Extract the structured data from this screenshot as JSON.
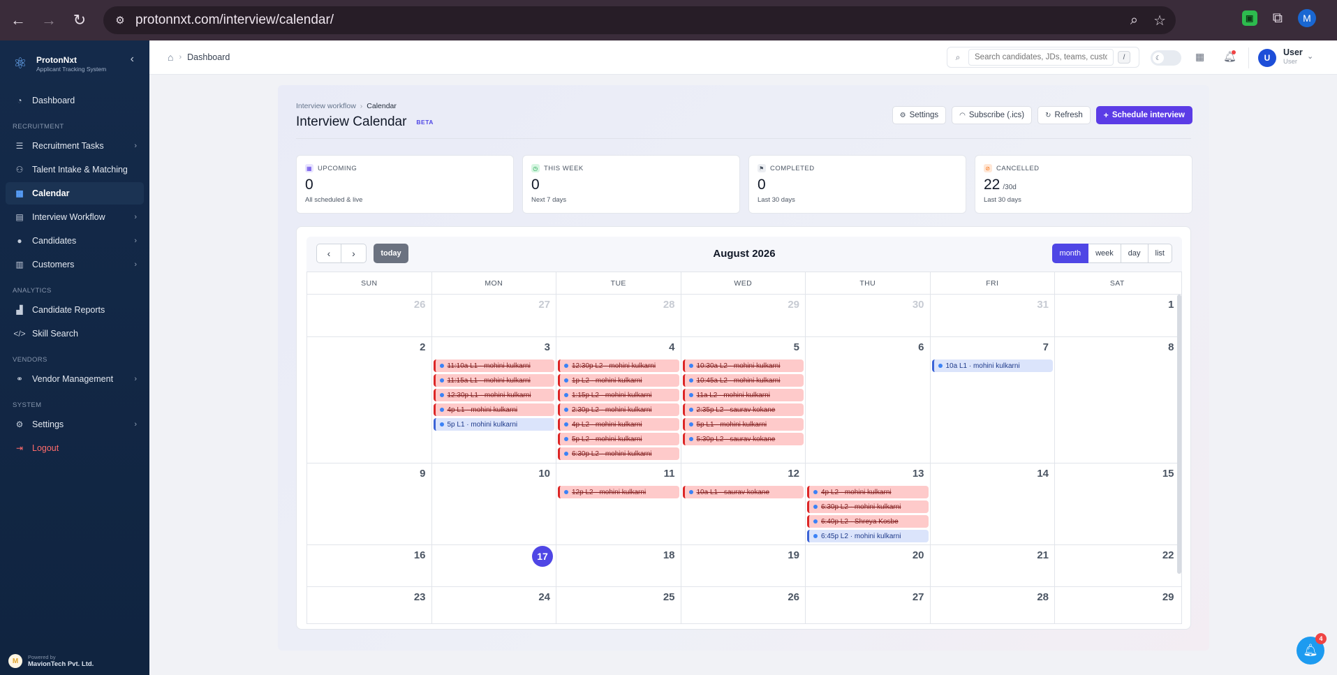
{
  "browser": {
    "url": "protonnxt.com/interview/calendar/",
    "profile_initial": "M"
  },
  "brand": {
    "name": "ProtonNxt",
    "tagline": "Applicant Tracking System"
  },
  "sidebar": {
    "dashboard": "Dashboard",
    "section_recruitment": "RECRUITMENT",
    "recruitment_tasks": "Recruitment Tasks",
    "talent_intake": "Talent Intake & Matching",
    "calendar": "Calendar",
    "interview_workflow": "Interview Workflow",
    "candidates": "Candidates",
    "customers": "Customers",
    "section_analytics": "ANALYTICS",
    "candidate_reports": "Candidate Reports",
    "skill_search": "Skill Search",
    "section_vendors": "VENDORS",
    "vendor_management": "Vendor Management",
    "section_system": "SYSTEM",
    "settings": "Settings",
    "logout": "Logout",
    "powered_by": "Powered by",
    "powered_company": "MavionTech Pvt. Ltd."
  },
  "header": {
    "breadcrumb": "Dashboard",
    "search_placeholder": "Search candidates, JDs, teams, customers",
    "search_kbd": "/",
    "user_initial": "U",
    "user_name": "User",
    "user_role": "User"
  },
  "page": {
    "crumb_parent": "Interview workflow",
    "crumb_current": "Calendar",
    "title": "Interview Calendar",
    "badge": "BETA",
    "btn_settings": "Settings",
    "btn_subscribe": "Subscribe (.ics)",
    "btn_refresh": "Refresh",
    "btn_schedule": "Schedule interview"
  },
  "stats": {
    "upcoming": {
      "label": "UPCOMING",
      "value": "0",
      "sub": "All scheduled & live"
    },
    "this_week": {
      "label": "THIS WEEK",
      "value": "0",
      "sub": "Next 7 days"
    },
    "completed": {
      "label": "COMPLETED",
      "value": "0",
      "sub": "Last 30 days"
    },
    "cancelled": {
      "label": "CANCELLED",
      "value": "22",
      "suffix": "/30d",
      "sub": "Last 30 days"
    }
  },
  "calendar": {
    "title": "August 2026",
    "today_label": "today",
    "views": [
      "month",
      "week",
      "day",
      "list"
    ],
    "active_view": "month",
    "weekdays": [
      "SUN",
      "MON",
      "TUE",
      "WED",
      "THU",
      "FRI",
      "SAT"
    ],
    "today_day": 17,
    "weeks": [
      [
        {
          "d": "26",
          "other": true,
          "events": []
        },
        {
          "d": "27",
          "other": true,
          "events": []
        },
        {
          "d": "28",
          "other": true,
          "events": []
        },
        {
          "d": "29",
          "other": true,
          "events": []
        },
        {
          "d": "30",
          "other": true,
          "events": []
        },
        {
          "d": "31",
          "other": true,
          "events": []
        },
        {
          "d": "1",
          "events": []
        }
      ],
      [
        {
          "d": "2",
          "events": []
        },
        {
          "d": "3",
          "events": [
            {
              "t": "11:10a L1 · mohini kulkarni",
              "status": "cancelled"
            },
            {
              "t": "11:15a L1 · mohini kulkarni",
              "status": "cancelled"
            },
            {
              "t": "12:30p L1 · mohini kulkarni",
              "status": "cancelled"
            },
            {
              "t": "4p L1 · mohini kulkarni",
              "status": "cancelled"
            },
            {
              "t": "5p L1 · mohini kulkarni",
              "status": "scheduled"
            }
          ]
        },
        {
          "d": "4",
          "events": [
            {
              "t": "12:30p L2 · mohini kulkarni",
              "status": "cancelled"
            },
            {
              "t": "1p L2 · mohini kulkarni",
              "status": "cancelled"
            },
            {
              "t": "1:15p L2 · mohini kulkarni",
              "status": "cancelled"
            },
            {
              "t": "2:30p L2 · mohini kulkarni",
              "status": "cancelled"
            },
            {
              "t": "4p L2 · mohini kulkarni",
              "status": "cancelled"
            },
            {
              "t": "5p L2 · mohini kulkarni",
              "status": "cancelled"
            },
            {
              "t": "6:30p L2 · mohini kulkarni",
              "status": "cancelled"
            }
          ]
        },
        {
          "d": "5",
          "events": [
            {
              "t": "10:30a L2 · mohini kulkarni",
              "status": "cancelled"
            },
            {
              "t": "10:45a L2 · mohini kulkarni",
              "status": "cancelled"
            },
            {
              "t": "11a L2 · mohini kulkarni",
              "status": "cancelled"
            },
            {
              "t": "2:35p L2 · saurav kokane",
              "status": "cancelled"
            },
            {
              "t": "5p L1 · mohini kulkarni",
              "status": "cancelled"
            },
            {
              "t": "5:30p L2 · saurav kokane",
              "status": "cancelled"
            }
          ]
        },
        {
          "d": "6",
          "events": []
        },
        {
          "d": "7",
          "events": [
            {
              "t": "10a L1 · mohini kulkarni",
              "status": "scheduled"
            }
          ]
        },
        {
          "d": "8",
          "events": []
        }
      ],
      [
        {
          "d": "9",
          "events": []
        },
        {
          "d": "10",
          "events": []
        },
        {
          "d": "11",
          "events": [
            {
              "t": "12p L2 · mohini kulkarni",
              "status": "cancelled"
            }
          ]
        },
        {
          "d": "12",
          "events": [
            {
              "t": "10a L1 · saurav kokane",
              "status": "cancelled"
            }
          ]
        },
        {
          "d": "13",
          "events": [
            {
              "t": "4p L2 · mohini kulkarni",
              "status": "cancelled"
            },
            {
              "t": "6:30p L2 · mohini kulkarni",
              "status": "cancelled"
            },
            {
              "t": "6:40p L2 · Shreya Kosbe",
              "status": "cancelled"
            },
            {
              "t": "6:45p L2 · mohini kulkarni",
              "status": "scheduled"
            }
          ]
        },
        {
          "d": "14",
          "events": []
        },
        {
          "d": "15",
          "events": []
        }
      ],
      [
        {
          "d": "16",
          "events": []
        },
        {
          "d": "17",
          "today": true,
          "events": []
        },
        {
          "d": "18",
          "events": []
        },
        {
          "d": "19",
          "events": []
        },
        {
          "d": "20",
          "events": []
        },
        {
          "d": "21",
          "events": []
        },
        {
          "d": "22",
          "events": []
        }
      ],
      [
        {
          "d": "23",
          "events": []
        },
        {
          "d": "24",
          "events": []
        },
        {
          "d": "25",
          "events": []
        },
        {
          "d": "26",
          "events": []
        },
        {
          "d": "27",
          "events": []
        },
        {
          "d": "28",
          "events": []
        },
        {
          "d": "29",
          "events": []
        }
      ]
    ]
  },
  "notifications": {
    "count": "4"
  }
}
